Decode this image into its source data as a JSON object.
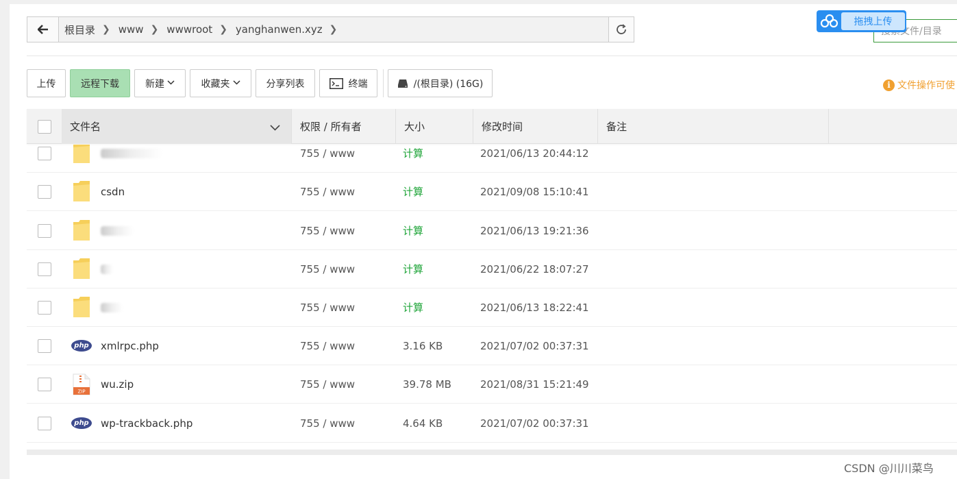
{
  "path": {
    "crumbs": [
      "根目录",
      "www",
      "wwwroot",
      "yanghanwen.xyz"
    ]
  },
  "search": {
    "placeholder": "搜索文件/目录"
  },
  "upload_widget": {
    "label": "拖拽上传"
  },
  "toolbar": {
    "upload": "上传",
    "remote_download": "远程下载",
    "new": "新建",
    "favorites": "收藏夹",
    "share_list": "分享列表",
    "terminal": "终端",
    "disk": "/(根目录) (16G)"
  },
  "notice": {
    "text": "文件操作可使"
  },
  "table": {
    "headers": {
      "name": "文件名",
      "perm": "权限 / 所有者",
      "size": "大小",
      "mtime": "修改时间",
      "remark": "备注"
    },
    "rows": [
      {
        "type": "folder",
        "name": "",
        "perm": "755 / www",
        "size": "计算",
        "mtime": "2021/06/13 20:44:12",
        "size_is_calc": true
      },
      {
        "type": "folder",
        "name": "csdn",
        "perm": "755 / www",
        "size": "计算",
        "mtime": "2021/09/08 15:10:41",
        "size_is_calc": true
      },
      {
        "type": "folder",
        "name": "",
        "perm": "755 / www",
        "size": "计算",
        "mtime": "2021/06/13 19:21:36",
        "size_is_calc": true
      },
      {
        "type": "folder",
        "name": "",
        "perm": "755 / www",
        "size": "计算",
        "mtime": "2021/06/22 18:07:27",
        "size_is_calc": true
      },
      {
        "type": "folder",
        "name": "",
        "perm": "755 / www",
        "size": "计算",
        "mtime": "2021/06/13 18:22:41",
        "size_is_calc": true
      },
      {
        "type": "php",
        "name": "xmlrpc.php",
        "perm": "755 / www",
        "size": "3.16 KB",
        "mtime": "2021/07/02 00:37:31",
        "size_is_calc": false
      },
      {
        "type": "zip",
        "name": "wu.zip",
        "perm": "755 / www",
        "size": "39.78 MB",
        "mtime": "2021/08/31 15:21:49",
        "size_is_calc": false
      },
      {
        "type": "php",
        "name": "wp-trackback.php",
        "perm": "755 / www",
        "size": "4.64 KB",
        "mtime": "2021/07/02 00:37:31",
        "size_is_calc": false
      }
    ]
  },
  "watermark": "CSDN @川川菜鸟",
  "colors": {
    "accent_green": "#20a53a",
    "button_green": "#a9dfb3",
    "upload_blue": "#2a8ef0",
    "notice_orange": "#f0a030"
  }
}
